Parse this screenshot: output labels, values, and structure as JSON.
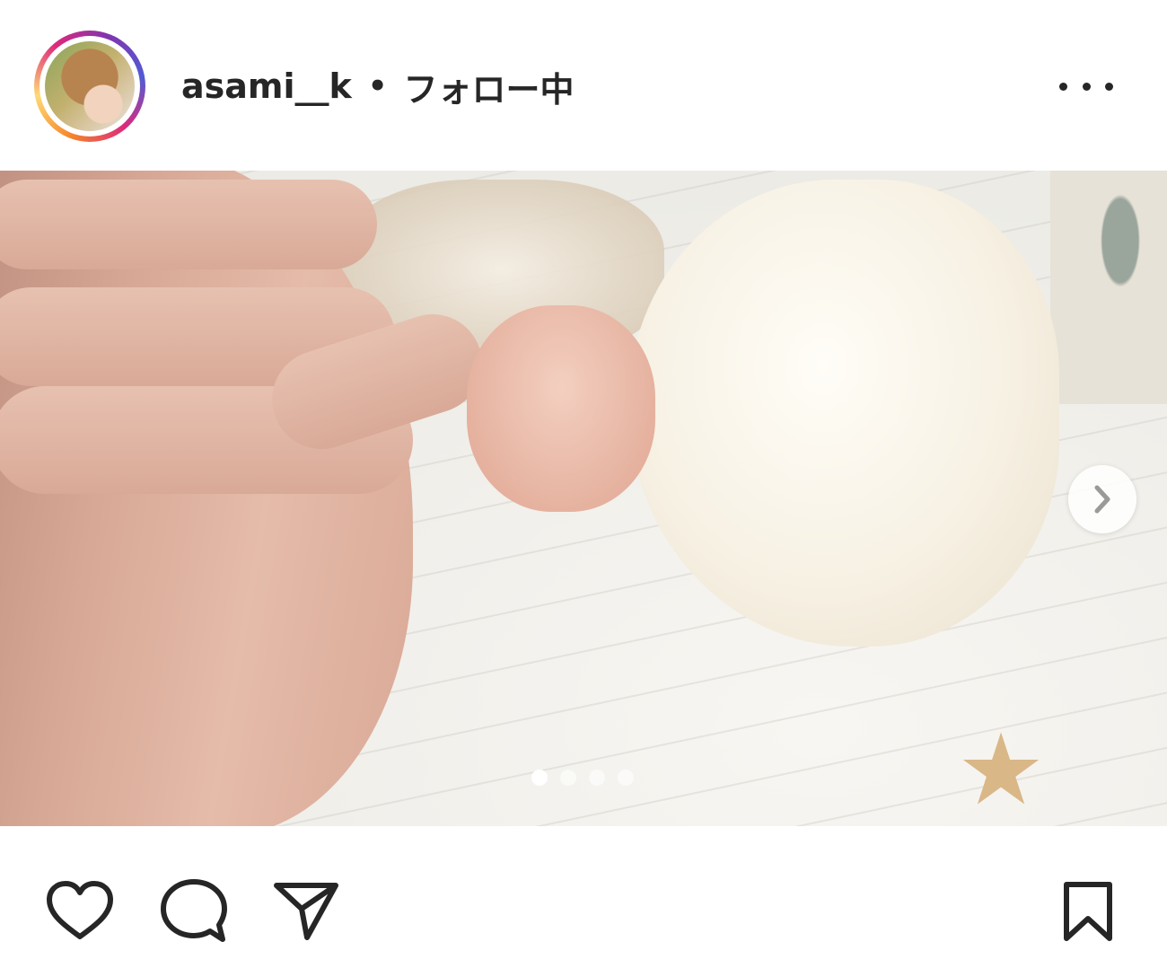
{
  "post": {
    "username": "asami__k",
    "separator": "•",
    "follow_status": "フォロー中",
    "more_icon": "more-horizontal-icon"
  },
  "carousel": {
    "total_slides": 4,
    "active_slide": 1,
    "next_icon": "chevron-right-icon"
  },
  "actions": {
    "like_icon": "heart-icon",
    "comment_icon": "comment-icon",
    "share_icon": "paper-plane-icon",
    "save_icon": "bookmark-icon"
  },
  "colors": {
    "text": "#262626",
    "ring_start": "#f58529",
    "ring_mid": "#dd2a7b",
    "ring_end": "#515bd4"
  }
}
